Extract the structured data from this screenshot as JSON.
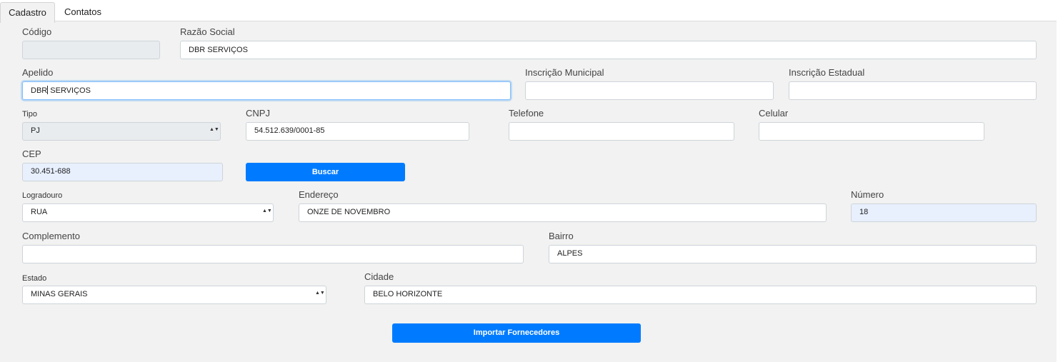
{
  "tabs": [
    {
      "label": "Cadastro",
      "active": true
    },
    {
      "label": "Contatos",
      "active": false
    }
  ],
  "form": {
    "codigo": {
      "label": "Código",
      "value": ""
    },
    "razao_social": {
      "label": "Razão Social",
      "value": "DBR SERVIÇOS"
    },
    "apelido": {
      "label": "Apelido",
      "value_before_cursor": "DBR",
      "value_after_cursor": " SERVIÇOS"
    },
    "inscricao_municipal": {
      "label": "Inscrição Municipal",
      "value": ""
    },
    "inscricao_estadual": {
      "label": "Inscrição Estadual",
      "value": ""
    },
    "tipo": {
      "label": "Tipo",
      "value": "PJ"
    },
    "cnpj": {
      "label": "CNPJ",
      "value": "54.512.639/0001-85"
    },
    "telefone": {
      "label": "Telefone",
      "value": ""
    },
    "celular": {
      "label": "Celular",
      "value": ""
    },
    "cep": {
      "label": "CEP",
      "value": "30.451-688"
    },
    "buscar_label": "Buscar",
    "logradouro": {
      "label": "Logradouro",
      "value": "RUA"
    },
    "endereco": {
      "label": "Endereço",
      "value": "ONZE DE NOVEMBRO"
    },
    "numero": {
      "label": "Número",
      "value": "18"
    },
    "complemento": {
      "label": "Complemento",
      "value": ""
    },
    "bairro": {
      "label": "Bairro",
      "value": "ALPES"
    },
    "estado": {
      "label": "Estado",
      "value": "MINAS GERAIS"
    },
    "cidade": {
      "label": "Cidade",
      "value": "BELO HORIZONTE"
    },
    "importar_label": "Importar Fornecedores"
  },
  "icons": {
    "select_arrows": "updown-arrows-icon"
  },
  "colors": {
    "primary": "#007bff",
    "panel_bg": "#f1f2f1",
    "autofill_bg": "#e8f0fe"
  }
}
